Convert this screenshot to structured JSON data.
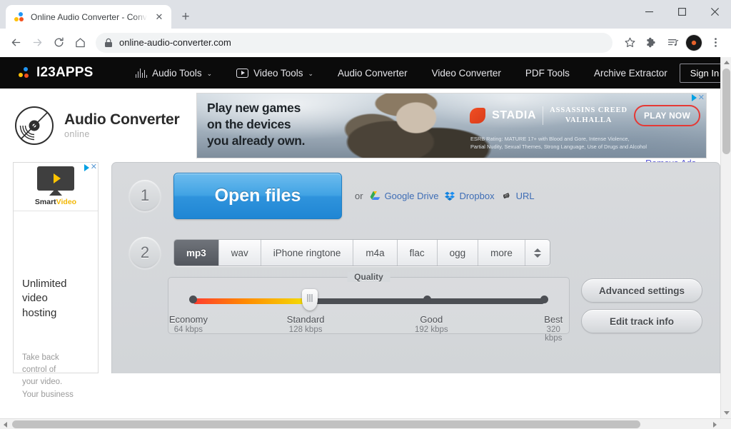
{
  "browser": {
    "tab": {
      "title": "Online Audio Converter - Conver",
      "close_label": "✕"
    },
    "new_tab_label": "+",
    "window": {
      "minimize": "minimize-button",
      "maximize": "maximize-button",
      "close": "close-button"
    },
    "toolbar": {
      "back": "back-button",
      "forward": "forward-button",
      "reload": "reload-button",
      "home": "home-button",
      "url": "online-audio-converter.com",
      "bookmark": "star-icon",
      "extensions": "puzzle-icon",
      "media": "media-list-icon",
      "profile": "profile-avatar",
      "menu": "three-dot-menu"
    }
  },
  "sitenav": {
    "brand": "I23APPS",
    "items": [
      {
        "label": "Audio Tools",
        "icon": "waveform-icon",
        "caret": "⌄"
      },
      {
        "label": "Video Tools",
        "icon": "video-play-icon",
        "caret": "⌄"
      },
      {
        "label": "Audio Converter",
        "icon": "",
        "caret": ""
      },
      {
        "label": "Video Converter",
        "icon": "",
        "caret": ""
      },
      {
        "label": "PDF Tools",
        "icon": "",
        "caret": ""
      },
      {
        "label": "Archive Extractor",
        "icon": "",
        "caret": ""
      }
    ],
    "signin": "Sign In"
  },
  "app": {
    "title": "Audio Converter",
    "subtitle": "online",
    "logo_icon": "vinyl-record-icon"
  },
  "banner_ad": {
    "headline": "Play new games\non the devices\nyou already own.",
    "brand": "STADIA",
    "game_title": "ASSASSINS CREED\nVALHALLA",
    "cta": "PLAY NOW",
    "rating": "ESRB Rating: MATURE 17+ with Blood and Gore, Intense Violence,\nPartial Nudity, Sexual Themes, Strong Language, Use of Drugs and Alcohol",
    "adchoices_close": "✕"
  },
  "remove_ads": "Remove Ads",
  "side_ad": {
    "brand_s": "Smart",
    "brand_v": "Video",
    "headline": "Unlimited\nvideo\nhosting",
    "body": "Take back\ncontrol of\nyour video.\nYour business",
    "close": "✕"
  },
  "step1": {
    "number": "1",
    "open_files": "Open files",
    "or": "or",
    "sources": [
      {
        "label": "Google Drive",
        "icon": "google-drive-icon"
      },
      {
        "label": "Dropbox",
        "icon": "dropbox-icon"
      },
      {
        "label": "URL",
        "icon": "link-icon"
      }
    ]
  },
  "step2": {
    "number": "2",
    "formats": [
      {
        "label": "mp3",
        "active": true
      },
      {
        "label": "wav",
        "active": false
      },
      {
        "label": "iPhone ringtone",
        "active": false
      },
      {
        "label": "m4a",
        "active": false
      },
      {
        "label": "flac",
        "active": false
      },
      {
        "label": "ogg",
        "active": false
      },
      {
        "label": "more",
        "active": false
      }
    ],
    "spinner_icon": "up-down-spinner-icon"
  },
  "quality": {
    "legend": "Quality",
    "selected_index": 1,
    "stops": [
      {
        "name": "Economy",
        "bitrate": "64 kbps",
        "pct": 0
      },
      {
        "name": "Standard",
        "bitrate": "128 kbps",
        "pct": 33.3
      },
      {
        "name": "Good",
        "bitrate": "192 kbps",
        "pct": 66.6
      },
      {
        "name": "Best",
        "bitrate": "320 kbps",
        "pct": 100
      }
    ],
    "buttons": [
      {
        "label": "Advanced settings"
      },
      {
        "label": "Edit track info"
      }
    ]
  },
  "colors": {
    "accent_blue": "#2f93dc",
    "nav_black": "#0b0b0b",
    "panel_grey": "#d6d9dc",
    "link_blue": "#3e6db5",
    "remove_ads": "#5a57d6"
  }
}
